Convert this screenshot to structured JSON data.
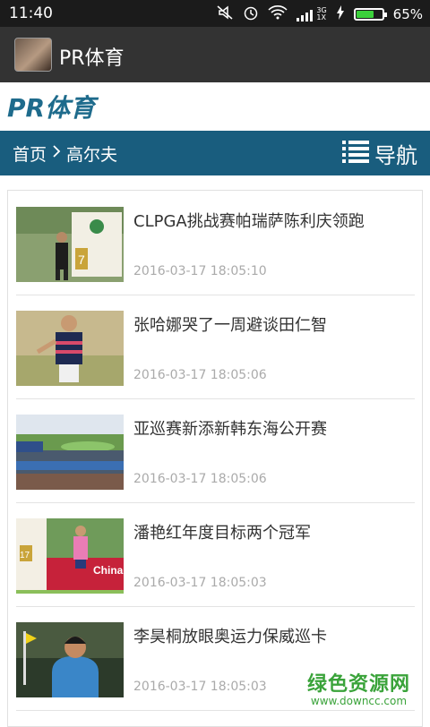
{
  "status_bar": {
    "time": "11:40",
    "network_label": "3G",
    "sim_label": "1X",
    "battery_percent_text": "65%",
    "battery_level": 0.65,
    "icons": [
      "mute-icon",
      "alarm-icon",
      "wifi-icon",
      "signal-icon",
      "charging-icon",
      "battery-icon"
    ]
  },
  "action_bar": {
    "title": "PR体育"
  },
  "site": {
    "logo_text": "PR体育"
  },
  "nav": {
    "breadcrumb": [
      "首页",
      "高尔夫"
    ],
    "menu_label": "导航"
  },
  "articles": [
    {
      "title": "CLPGA挑战赛帕瑞萨陈利庆领跑",
      "time": "2016-03-17 18:05:10",
      "sign": "7"
    },
    {
      "title": "张哈娜哭了一周避谈田仁智",
      "time": "2016-03-17 18:05:06"
    },
    {
      "title": "亚巡赛新添新韩东海公开赛",
      "time": "2016-03-17 18:05:06"
    },
    {
      "title": "潘艳红年度目标两个冠军",
      "time": "2016-03-17 18:05:03",
      "sign": "17",
      "banner": "China LPGA"
    },
    {
      "title": "李昊桐放眼奥运力保威巡卡",
      "time": "2016-03-17 18:05:03"
    }
  ],
  "watermark": {
    "cn": "绿色资源网",
    "url": "www.downcc.com"
  },
  "colors": {
    "nav_bg": "#195d7e",
    "logo": "#1e6b8c",
    "action_bar": "#333333",
    "status_bar": "#1b1b1b"
  }
}
